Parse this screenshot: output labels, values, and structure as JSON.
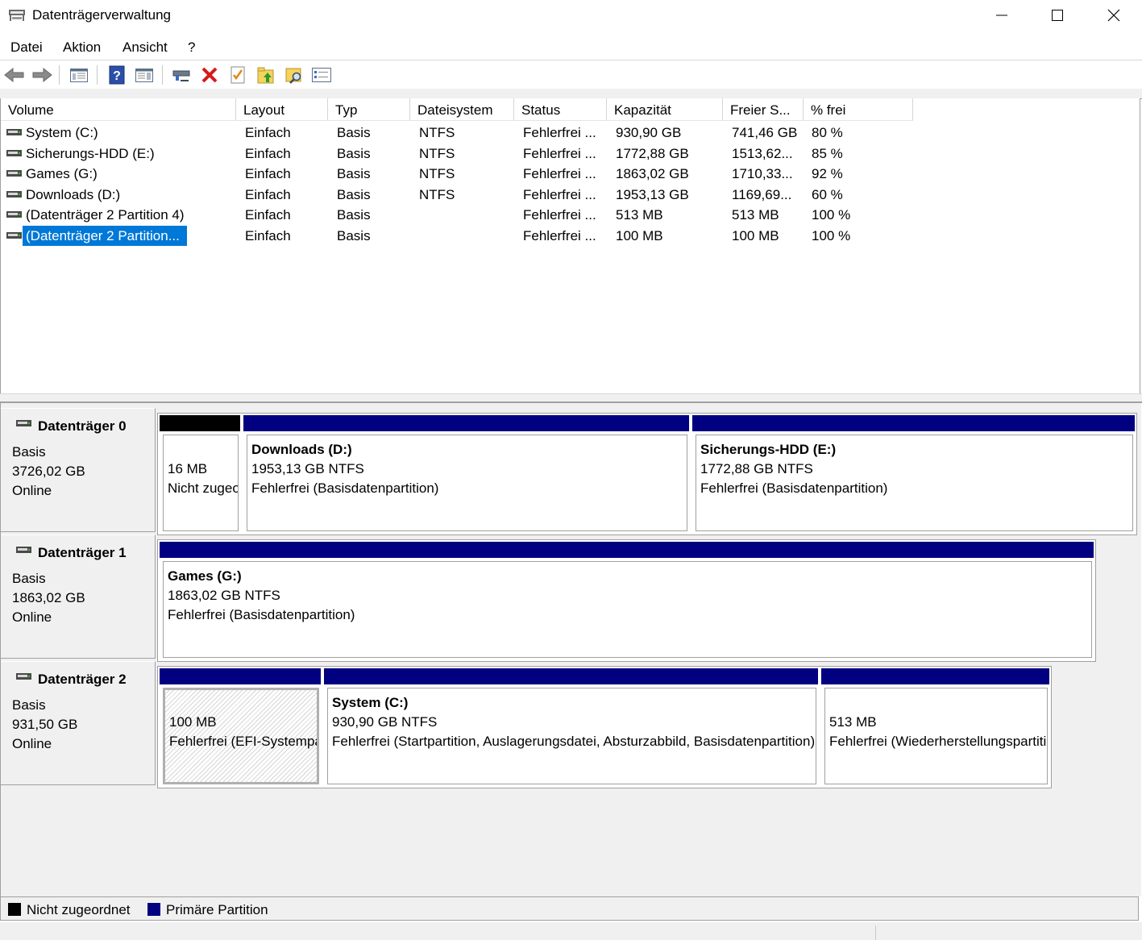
{
  "window": {
    "title": "Datenträgerverwaltung"
  },
  "menu": [
    "Datei",
    "Aktion",
    "Ansicht",
    "?"
  ],
  "toolbar": {
    "icons": [
      "back-arrow-icon",
      "forward-arrow-icon",
      "console-tree-icon",
      "help-icon",
      "properties-pane-icon",
      "connect-icon",
      "delete-icon",
      "checklist-icon",
      "folder-up-icon",
      "folder-search-icon",
      "details-view-icon"
    ]
  },
  "volume_list": {
    "columns": [
      "Volume",
      "Layout",
      "Typ",
      "Dateisystem",
      "Status",
      "Kapazität",
      "Freier S...",
      "% frei"
    ],
    "rows": [
      [
        "System (C:)",
        "Einfach",
        "Basis",
        "NTFS",
        "Fehlerfrei ...",
        "930,90 GB",
        "741,46 GB",
        "80 %"
      ],
      [
        "Sicherungs-HDD (E:)",
        "Einfach",
        "Basis",
        "NTFS",
        "Fehlerfrei ...",
        "1772,88 GB",
        "1513,62...",
        "85 %"
      ],
      [
        "Games (G:)",
        "Einfach",
        "Basis",
        "NTFS",
        "Fehlerfrei ...",
        "1863,02 GB",
        "1710,33...",
        "92 %"
      ],
      [
        "Downloads (D:)",
        "Einfach",
        "Basis",
        "NTFS",
        "Fehlerfrei ...",
        "1953,13 GB",
        "1169,69...",
        "60 %"
      ],
      [
        "(Datenträger 2 Partition 4)",
        "Einfach",
        "Basis",
        "",
        "Fehlerfrei ...",
        "513 MB",
        "513 MB",
        "100 %"
      ],
      [
        "(Datenträger 2 Partition...",
        "Einfach",
        "Basis",
        "",
        "Fehlerfrei ...",
        "100 MB",
        "100 MB",
        "100 %"
      ]
    ],
    "selected_row": 5
  },
  "disks": [
    {
      "name": "Datenträger 0",
      "type": "Basis",
      "size": "3726,02 GB",
      "state": "Online",
      "partitions": [
        {
          "bar": "unallocated",
          "title": "",
          "size": "16 MB",
          "status": "Nicht zugeordnet"
        },
        {
          "bar": "primary",
          "title": "Downloads  (D:)",
          "size": "1953,13 GB NTFS",
          "status": "Fehlerfrei (Basisdatenpartition)"
        },
        {
          "bar": "primary",
          "title": "Sicherungs-HDD  (E:)",
          "size": "1772,88 GB NTFS",
          "status": "Fehlerfrei (Basisdatenpartition)"
        }
      ]
    },
    {
      "name": "Datenträger 1",
      "type": "Basis",
      "size": "1863,02 GB",
      "state": "Online",
      "partitions": [
        {
          "bar": "primary",
          "title": "Games  (G:)",
          "size": "1863,02 GB NTFS",
          "status": "Fehlerfrei (Basisdatenpartition)"
        }
      ]
    },
    {
      "name": "Datenträger 2",
      "type": "Basis",
      "size": "931,50 GB",
      "state": "Online",
      "partitions": [
        {
          "bar": "primary",
          "title": "",
          "size": "100 MB",
          "status": "Fehlerfrei (EFI-Systempartition)"
        },
        {
          "bar": "primary",
          "title": "System  (C:)",
          "size": "930,90 GB NTFS",
          "status": "Fehlerfrei (Startpartition, Auslagerungsdatei, Absturzabbild, Basisdatenpartition)"
        },
        {
          "bar": "primary",
          "title": "",
          "size": "513 MB",
          "status": "Fehlerfrei (Wiederherstellungspartition)"
        }
      ]
    }
  ],
  "legend": [
    {
      "label": "Nicht zugeordnet",
      "color": "#000000"
    },
    {
      "label": "Primäre Partition",
      "color": "#000080"
    }
  ],
  "colors": {
    "primary_bar": "#000080",
    "unallocated_bar": "#000000",
    "selection": "#0078d7"
  }
}
